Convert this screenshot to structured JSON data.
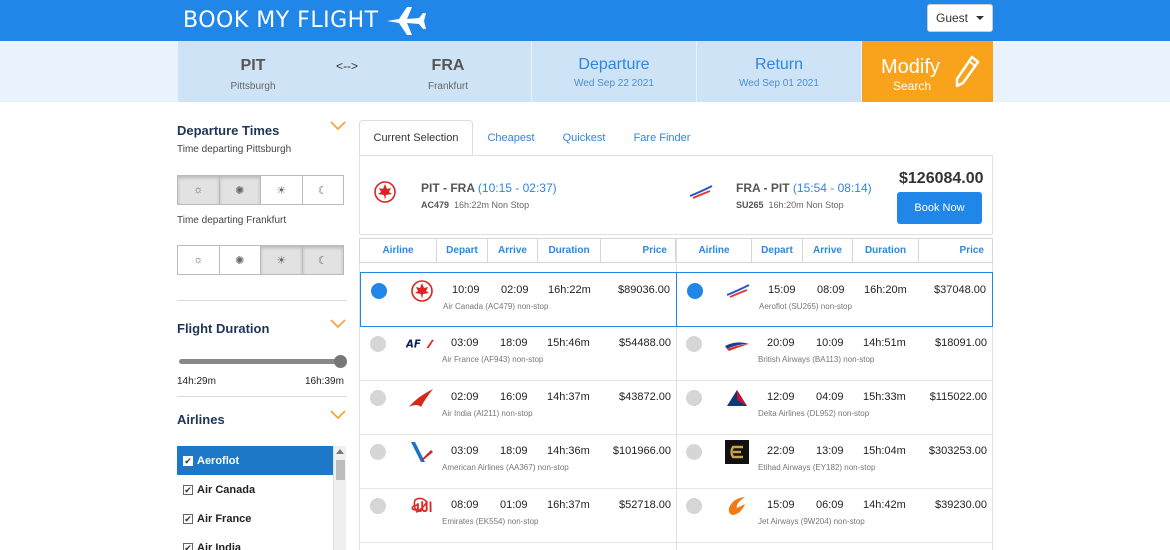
{
  "header": {
    "logo_text": "BOOK MY FLIGHT",
    "user_menu": "Guest"
  },
  "search": {
    "origin_code": "PIT",
    "origin_city": "Pittsburgh",
    "separator": "<-->",
    "dest_code": "FRA",
    "dest_city": "Frankfurt",
    "departure_label": "Departure",
    "departure_date": "Wed Sep 22 2021",
    "return_label": "Return",
    "return_date": "Wed Sep 01 2021",
    "modify_label": "Modify",
    "modify_sub": "Search"
  },
  "sidebar": {
    "departure_title": "Departure Times",
    "departing_origin": "Time departing Pittsburgh",
    "departing_dest": "Time departing Frankfurt",
    "duration_title": "Flight Duration",
    "duration_min": "14h:29m",
    "duration_max": "16h:39m",
    "airlines_title": "Airlines",
    "airlines": [
      {
        "name": "Aeroflot",
        "checked": true
      },
      {
        "name": "Air Canada",
        "checked": true
      },
      {
        "name": "Air France",
        "checked": true
      },
      {
        "name": "Air India",
        "checked": true
      }
    ]
  },
  "tabs": [
    "Current Selection",
    "Cheapest",
    "Quickest",
    "Fare Finder"
  ],
  "summary": {
    "outbound_route": "PIT - FRA",
    "outbound_time": "(10:15 - 02:37)",
    "outbound_flight": "AC479",
    "outbound_meta": "16h:22m Non Stop",
    "return_route": "FRA - PIT",
    "return_time": "(15:54 - 08:14)",
    "return_flight": "SU265",
    "return_meta": "16h:20m Non Stop",
    "total": "$126084.00",
    "book_label": "Book Now"
  },
  "columns": [
    "Airline",
    "Depart",
    "Arrive",
    "Duration",
    "Price"
  ],
  "outbound": [
    {
      "depart": "10:09",
      "arrive": "02:09",
      "duration": "16h:22m",
      "price": "$89036.00",
      "info": "Air Canada  (AC479)  non-stop",
      "logo": "air-canada-logo",
      "selected": true
    },
    {
      "depart": "03:09",
      "arrive": "18:09",
      "duration": "15h:46m",
      "price": "$54488.00",
      "info": "Air France  (AF943)  non-stop",
      "logo": "air-france-logo",
      "selected": false
    },
    {
      "depart": "02:09",
      "arrive": "16:09",
      "duration": "14h:37m",
      "price": "$43872.00",
      "info": "Air India  (AI211)  non-stop",
      "logo": "air-india-logo",
      "selected": false
    },
    {
      "depart": "03:09",
      "arrive": "18:09",
      "duration": "14h:36m",
      "price": "$101966.00",
      "info": "American Airlines  (AA367)  non-stop",
      "logo": "american-airlines-logo",
      "selected": false
    },
    {
      "depart": "08:09",
      "arrive": "01:09",
      "duration": "16h:37m",
      "price": "$52718.00",
      "info": "Emirates  (EK554)  non-stop",
      "logo": "emirates-logo",
      "selected": false
    }
  ],
  "inbound": [
    {
      "depart": "15:09",
      "arrive": "08:09",
      "duration": "16h:20m",
      "price": "$37048.00",
      "info": "Aeroflot  (SU265)  non-stop",
      "logo": "aeroflot-logo",
      "selected": true
    },
    {
      "depart": "20:09",
      "arrive": "10:09",
      "duration": "14h:51m",
      "price": "$18091.00",
      "info": "British Airways  (BA113)  non-stop",
      "logo": "british-airways-logo",
      "selected": false
    },
    {
      "depart": "12:09",
      "arrive": "04:09",
      "duration": "15h:33m",
      "price": "$115022.00",
      "info": "Delta Airlines  (DL952)  non-stop",
      "logo": "delta-logo",
      "selected": false
    },
    {
      "depart": "22:09",
      "arrive": "13:09",
      "duration": "15h:04m",
      "price": "$303253.00",
      "info": "Etihad Airways  (EY182)  non-stop",
      "logo": "etihad-logo",
      "selected": false
    },
    {
      "depart": "15:09",
      "arrive": "06:09",
      "duration": "14h:42m",
      "price": "$39230.00",
      "info": "Jet Airways  (9W204)  non-stop",
      "logo": "jet-airways-logo",
      "selected": false
    }
  ],
  "colors": {
    "primary": "#2087e8",
    "accent": "#f8a31b",
    "band": "#cfe3f7"
  }
}
